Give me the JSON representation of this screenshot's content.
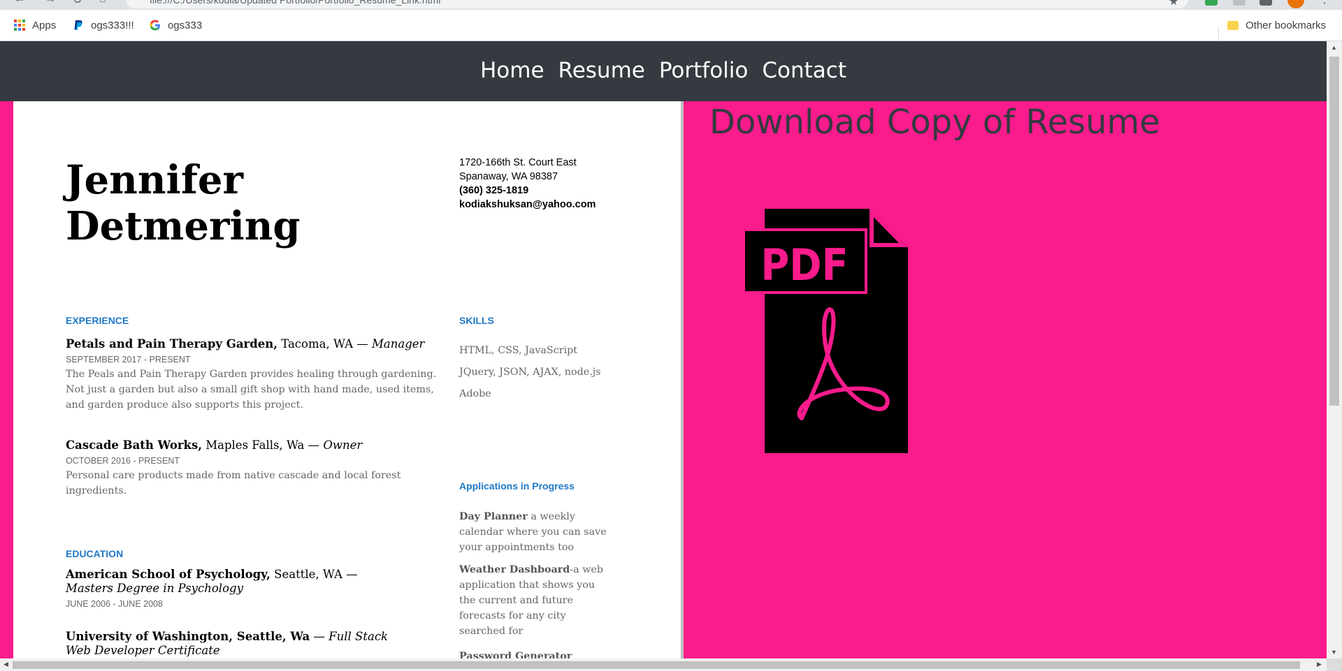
{
  "browser": {
    "url": "file:///C:/Users/kodia/Updated Portfolio/Portfolio_Resume_Link.html",
    "bookmarks": [
      {
        "label": "Apps",
        "icon": "apps-grid-icon"
      },
      {
        "label": "ogs333!!!",
        "icon": "paypal-icon"
      },
      {
        "label": "ogs333",
        "icon": "google-icon"
      }
    ],
    "other_bookmarks": "Other bookmarks"
  },
  "nav": {
    "links": [
      "Home",
      "Resume",
      "Portfolio",
      "Contact"
    ]
  },
  "resume": {
    "name_line1": "Jennifer",
    "name_line2": "Detmering",
    "address1": "1720-166th St. Court East",
    "address2": "Spanaway, WA 98387",
    "phone": "(360) 325-1819",
    "email": "kodiakshuksan@yahoo.com",
    "experience_heading": "EXPERIENCE",
    "jobs": [
      {
        "org": "Petals and Pain Therapy Garden,",
        "place": " Tacoma, WA — ",
        "role": "Manager",
        "date": "SEPTEMBER  2017 - PRESENT",
        "desc": "The Peals and Pain Therapy Garden  provides healing through gardening. Not just a garden but also a small gift shop with hand made, used items, and garden produce also supports this project."
      },
      {
        "org": "Cascade Bath Works,",
        "place": " Maples Falls, Wa — ",
        "role": "Owner",
        "date": "OCTOBER 2016 - PRESENT",
        "desc": "Personal care products made from native cascade and local forest ingredients."
      }
    ],
    "education_heading": "EDUCATION",
    "schools": [
      {
        "org": "American School of Psychology,",
        "place": " Seattle, WA — ",
        "role": "Masters Degree in Psychology",
        "date": "JUNE 2006 - JUNE 2008"
      },
      {
        "org": "University of Washington, Seattle, Wa",
        "place": " — ",
        "role": "Full Stack Web Developer Certificate",
        "date": ""
      }
    ],
    "skills_heading": "SKILLS",
    "skills": [
      "HTML, CSS, JavaScript",
      "JQuery, JSON, AJAX, node.js",
      "Adobe"
    ],
    "apps_heading": "Applications  in Progress",
    "apps": [
      {
        "name": "Day Planner",
        "desc": "  a weekly calendar where you can save your appointments too"
      },
      {
        "name": " Weather Dashboard",
        "desc": "-a web application that shows you the current and future forecasts for any city searched for"
      },
      {
        "name": "Password Generator",
        "desc": ""
      }
    ]
  },
  "download": {
    "title": "Download Copy of Resume",
    "icon_text": "PDF"
  },
  "colors": {
    "page_bg": "#fa1b8c",
    "navbar_bg": "#343a40",
    "section_heading": "#2079c7"
  }
}
